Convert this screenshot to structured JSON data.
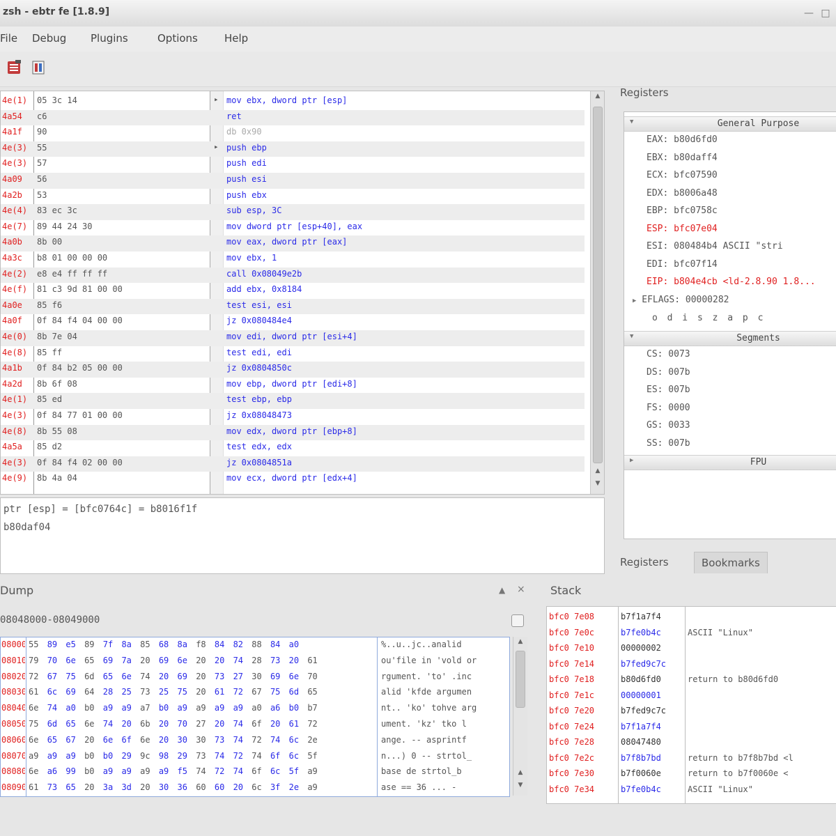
{
  "window": {
    "title": "zsh - ebtr fe [1.8.9]"
  },
  "menu": [
    "File",
    "Debug",
    "Plugins",
    "Options",
    "Help"
  ],
  "toolbar": {
    "icons": [
      "run-icon",
      "step-icon"
    ]
  },
  "cpu": {
    "rows": [
      {
        "addr": "4e(1)",
        "bytes": "05 3c 14",
        "mark": "▸",
        "ins": "mov ebx, dword ptr [esp]",
        "dim": false
      },
      {
        "addr": "4a54",
        "bytes": "c6",
        "mark": "",
        "ins": "ret",
        "dim": false
      },
      {
        "addr": "4a1f",
        "bytes": "90",
        "mark": "",
        "ins": "db 0x90",
        "dim": true
      },
      {
        "addr": "4e(3)",
        "bytes": "55",
        "mark": "▸",
        "ins": "push ebp",
        "dim": false
      },
      {
        "addr": "4e(3)",
        "bytes": "57",
        "mark": "",
        "ins": "push edi",
        "dim": false
      },
      {
        "addr": "4a09",
        "bytes": "56",
        "mark": "",
        "ins": "push esi",
        "dim": false
      },
      {
        "addr": "4a2b",
        "bytes": "53",
        "mark": "",
        "ins": "push ebx",
        "dim": false
      },
      {
        "addr": "4e(4)",
        "bytes": "83 ec 3c",
        "mark": "",
        "ins": "sub esp, 3C",
        "dim": false
      },
      {
        "addr": "4e(7)",
        "bytes": "89 44 24 30",
        "mark": "",
        "ins": "mov dword ptr [esp+40], eax",
        "dim": false
      },
      {
        "addr": "4a0b",
        "bytes": "8b 00",
        "mark": "",
        "ins": "mov eax, dword ptr [eax]",
        "dim": false
      },
      {
        "addr": "4a3c",
        "bytes": "b8 01 00 00 00",
        "mark": "",
        "ins": "mov ebx, 1",
        "dim": false
      },
      {
        "addr": "4e(2)",
        "bytes": "e8 e4 ff ff ff",
        "mark": "",
        "ins": "call 0x08049e2b",
        "dim": false
      },
      {
        "addr": "4e(f)",
        "bytes": "81 c3 9d 81 00 00",
        "mark": "",
        "ins": "add ebx, 0x8184",
        "dim": false
      },
      {
        "addr": "4a0e",
        "bytes": "85 f6",
        "mark": "",
        "ins": "test esi, esi",
        "dim": false
      },
      {
        "addr": "4a0f",
        "bytes": "0f 84 f4 04 00 00",
        "mark": "",
        "ins": "jz 0x080484e4",
        "dim": false
      },
      {
        "addr": "4e(0)",
        "bytes": "8b 7e 04",
        "mark": "",
        "ins": "mov edi, dword ptr [esi+4]",
        "dim": false
      },
      {
        "addr": "4e(8)",
        "bytes": "85 ff",
        "mark": "",
        "ins": "test edi, edi",
        "dim": false
      },
      {
        "addr": "4a1b",
        "bytes": "0f 84 b2 05 00 00",
        "mark": "",
        "ins": "jz 0x0804850c",
        "dim": false
      },
      {
        "addr": "4a2d",
        "bytes": "8b 6f 08",
        "mark": "",
        "ins": "mov ebp, dword ptr [edi+8]",
        "dim": false
      },
      {
        "addr": "4e(1)",
        "bytes": "85 ed",
        "mark": "",
        "ins": "test ebp, ebp",
        "dim": false
      },
      {
        "addr": "4e(3)",
        "bytes": "0f 84 77 01 00 00",
        "mark": "",
        "ins": "jz 0x08048473",
        "dim": false
      },
      {
        "addr": "4e(8)",
        "bytes": "8b 55 08",
        "mark": "",
        "ins": "mov edx, dword ptr [ebp+8]",
        "dim": false
      },
      {
        "addr": "4a5a",
        "bytes": "85 d2",
        "mark": "",
        "ins": "test edx, edx",
        "dim": false
      },
      {
        "addr": "4e(3)",
        "bytes": "0f 84 f4 02 00 00",
        "mark": "",
        "ins": "jz 0x0804851a",
        "dim": false
      },
      {
        "addr": "4e(9)",
        "bytes": "8b 4a 04",
        "mark": "",
        "ins": "mov ecx, dword ptr [edx+4]",
        "dim": false
      }
    ]
  },
  "status": {
    "line1": "ptr [esp] = [bfc0764c] = b8016f1f",
    "line2": "b80daf04"
  },
  "registers": {
    "title": "Registers",
    "groups": {
      "general": "General Purpose",
      "segments": "Segments",
      "fpu": "FPU"
    },
    "general": [
      {
        "text": "EAX: b80d6fd0",
        "red": false
      },
      {
        "text": "EBX: b80daff4",
        "red": false
      },
      {
        "text": "ECX: bfc07590",
        "red": false
      },
      {
        "text": "EDX: b8006a48",
        "red": false
      },
      {
        "text": "EBP: bfc0758c",
        "red": false
      },
      {
        "text": "ESP: bfc07e04",
        "red": true
      },
      {
        "text": "ESI: 080484b4 ASCII \"stri",
        "red": false
      },
      {
        "text": "EDI: bfc07f14",
        "red": false
      },
      {
        "text": "EIP: b804e4cb <ld-2.8.90 1.8...",
        "red": true
      }
    ],
    "eflags": {
      "text": "EFLAGS: 00000282",
      "flags": "o d i s z a p c"
    },
    "segments": [
      {
        "text": "CS: 0073"
      },
      {
        "text": "DS: 007b"
      },
      {
        "text": "ES: 007b"
      },
      {
        "text": "FS: 0000"
      },
      {
        "text": "GS: 0033"
      },
      {
        "text": "SS: 007b"
      }
    ]
  },
  "regtabs": [
    "Registers",
    "Bookmarks"
  ],
  "dump": {
    "title": "Dump",
    "range": "08048000-08049000",
    "rows": [
      {
        "addr": "08000",
        "hex": [
          "55",
          "89",
          "e5",
          "89",
          "7f",
          "8a",
          "85",
          "68",
          "8a",
          "f8",
          "84",
          "82",
          "88",
          "84",
          "a0"
        ],
        "text": "%..u..jc..analid"
      },
      {
        "addr": "08010",
        "hex": [
          "79",
          "70",
          "6e",
          "65",
          "69",
          "7a",
          "20",
          "69",
          "6e",
          "20",
          "20",
          "74",
          "28",
          "73",
          "20",
          "61"
        ],
        "text": "ou'file in 'vold or"
      },
      {
        "addr": "08020",
        "hex": [
          "72",
          "67",
          "75",
          "6d",
          "65",
          "6e",
          "74",
          "20",
          "69",
          "20",
          "73",
          "27",
          "30",
          "69",
          "6e",
          "70"
        ],
        "text": "rgument. 'to' .inc"
      },
      {
        "addr": "08030",
        "hex": [
          "61",
          "6c",
          "69",
          "64",
          "28",
          "25",
          "73",
          "25",
          "75",
          "20",
          "61",
          "72",
          "67",
          "75",
          "6d",
          "65"
        ],
        "text": "alid 'kfde argumen"
      },
      {
        "addr": "08040",
        "hex": [
          "6e",
          "74",
          "a0",
          "b0",
          "a9",
          "a9",
          "a7",
          "b0",
          "a9",
          "a9",
          "a9",
          "a9",
          "a0",
          "a6",
          "b0",
          "b7"
        ],
        "text": "nt.. 'ko' tohve arg"
      },
      {
        "addr": "08050",
        "hex": [
          "75",
          "6d",
          "65",
          "6e",
          "74",
          "20",
          "6b",
          "20",
          "70",
          "27",
          "20",
          "74",
          "6f",
          "20",
          "61",
          "72"
        ],
        "text": "ument. 'kz' tko l"
      },
      {
        "addr": "08060",
        "hex": [
          "6e",
          "65",
          "67",
          "20",
          "6e",
          "6f",
          "6e",
          "20",
          "30",
          "30",
          "73",
          "74",
          "72",
          "74",
          "6c",
          "2e"
        ],
        "text": "ange. -- asprintf"
      },
      {
        "addr": "08070",
        "hex": [
          "a9",
          "a9",
          "a9",
          "b0",
          "b0",
          "29",
          "9c",
          "98",
          "29",
          "73",
          "74",
          "72",
          "74",
          "6f",
          "6c",
          "5f"
        ],
        "text": "n...) 0 -- strtol_"
      },
      {
        "addr": "08080",
        "hex": [
          "6e",
          "a6",
          "99",
          "b0",
          "a9",
          "a9",
          "a9",
          "a9",
          "f5",
          "74",
          "72",
          "74",
          "6f",
          "6c",
          "5f",
          "a9"
        ],
        "text": "base de strtol_b"
      },
      {
        "addr": "08090",
        "hex": [
          "61",
          "73",
          "65",
          "20",
          "3a",
          "3d",
          "20",
          "30",
          "36",
          "60",
          "60",
          "20",
          "6c",
          "3f",
          "2e",
          "a9"
        ],
        "text": "ase == 36 ... -"
      }
    ]
  },
  "stack": {
    "title": "Stack",
    "rows": [
      {
        "addr": "bfc0 7e08",
        "val": "b7f1a7f4",
        "blue": false,
        "comment": ""
      },
      {
        "addr": "bfc0 7e0c",
        "val": "b7fe0b4c",
        "blue": true,
        "comment": "ASCII \"Linux\""
      },
      {
        "addr": "bfc0 7e10",
        "val": "00000002",
        "blue": false,
        "comment": ""
      },
      {
        "addr": "bfc0 7e14",
        "val": "b7fed9c7c",
        "blue": true,
        "comment": ""
      },
      {
        "addr": "bfc0 7e18",
        "val": "b80d6fd0",
        "blue": false,
        "comment": "return to b80d6fd0"
      },
      {
        "addr": "bfc0 7e1c",
        "val": "00000001",
        "blue": true,
        "comment": ""
      },
      {
        "addr": "bfc0 7e20",
        "val": "b7fed9c7c",
        "blue": false,
        "comment": ""
      },
      {
        "addr": "bfc0 7e24",
        "val": "b7f1a7f4",
        "blue": true,
        "comment": ""
      },
      {
        "addr": "bfc0 7e28",
        "val": "08047480",
        "blue": false,
        "comment": ""
      },
      {
        "addr": "bfc0 7e2c",
        "val": "b7f8b7bd",
        "blue": true,
        "comment": "return to b7f8b7bd <l"
      },
      {
        "addr": "bfc0 7e30",
        "val": "b7f0060e",
        "blue": false,
        "comment": "return to b7f0060e <"
      },
      {
        "addr": "bfc0 7e34",
        "val": "b7fe0b4c",
        "blue": true,
        "comment": "ASCII \"Linux\""
      }
    ]
  },
  "colors": {
    "address": "#e02020",
    "instruction": "#2a2ae8",
    "text": "#555555"
  }
}
